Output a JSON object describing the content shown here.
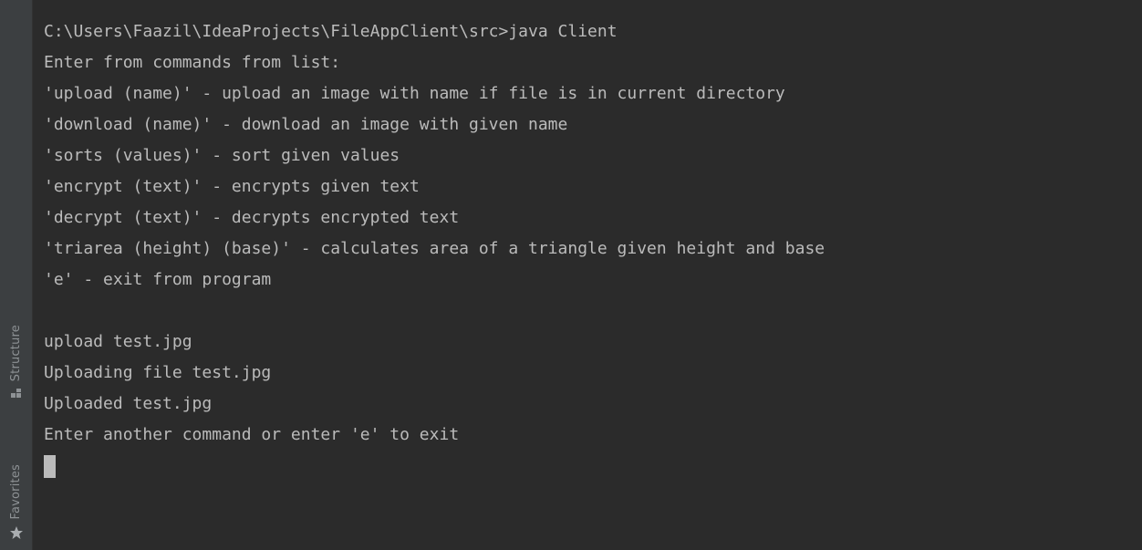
{
  "sidebar": {
    "structure_label": "Structure",
    "structure_icon": "structure-icon",
    "favorites_label": "Favorites",
    "favorites_icon": "star-icon"
  },
  "console": {
    "lines": [
      "C:\\Users\\Faazil\\IdeaProjects\\FileAppClient\\src>java Client",
      "Enter from commands from list:",
      "'upload (name)' - upload an image with name if file is in current directory",
      "'download (name)' - download an image with given name",
      "'sorts (values)' - sort given values",
      "'encrypt (text)' - encrypts given text",
      "'decrypt (text)' - decrypts encrypted text",
      "'triarea (height) (base)' - calculates area of a triangle given height and base",
      "'e' - exit from program",
      "",
      "upload test.jpg",
      "Uploading file test.jpg",
      "Uploaded test.jpg",
      "Enter another command or enter 'e' to exit"
    ],
    "input_value": ""
  },
  "colors": {
    "background": "#2b2b2b",
    "sidebar": "#3c3f41",
    "text": "#bbbbbb",
    "sidebar_text": "#8e9295"
  }
}
